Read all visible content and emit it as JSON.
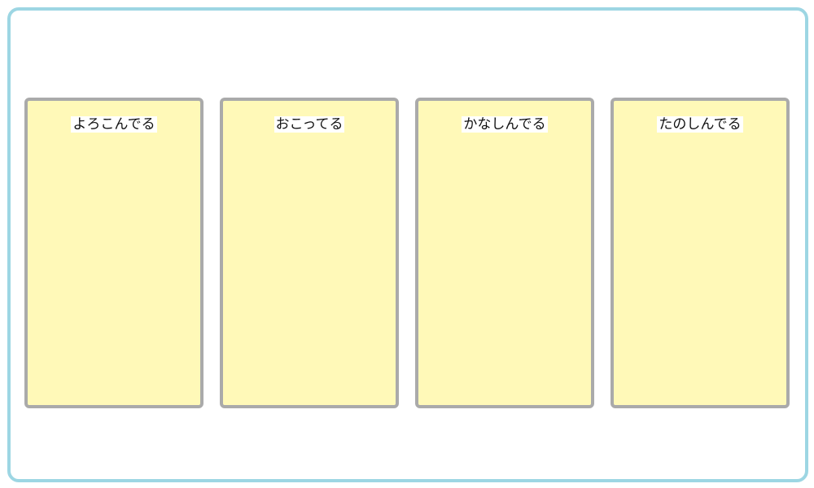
{
  "colors": {
    "frame_border": "#9dd6e3",
    "card_fill": "#fff9b8",
    "card_border": "#aaaaaa",
    "label_background": "#ffffff"
  },
  "cards": [
    {
      "label": "よろこんでる"
    },
    {
      "label": "おこってる"
    },
    {
      "label": "かなしんでる"
    },
    {
      "label": "たのしんでる"
    }
  ]
}
